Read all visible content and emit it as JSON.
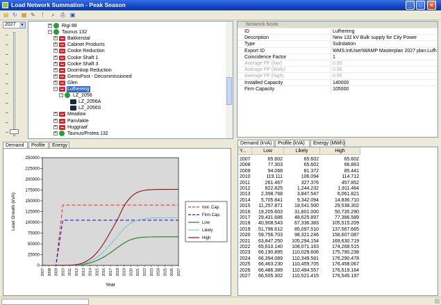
{
  "window": {
    "title": "Load Network Summation - Peak Season"
  },
  "year_selector": {
    "value": "2027"
  },
  "tree": {
    "nodes": [
      {
        "label": "Rigi 88",
        "icon": "green",
        "indent": 1,
        "expander": "+"
      },
      {
        "label": "Taunus 132",
        "icon": "green",
        "indent": 1,
        "expander": "-"
      },
      {
        "label": "Bakkerstal",
        "icon": "red",
        "indent": 2,
        "expander": "+"
      },
      {
        "label": "Cabinet Products",
        "icon": "red",
        "indent": 2,
        "expander": "+"
      },
      {
        "label": "Cooke Reduction",
        "icon": "red",
        "indent": 2,
        "expander": "+"
      },
      {
        "label": "Cooke Shaft 1",
        "icon": "red",
        "indent": 2,
        "expander": "+"
      },
      {
        "label": "Cooke Shaft 3",
        "icon": "red",
        "indent": 2,
        "expander": "+"
      },
      {
        "label": "Doornkop Reduction",
        "icon": "red",
        "indent": 2,
        "expander": "+"
      },
      {
        "label": "GemsPost - Decommissioned",
        "icon": "red",
        "indent": 2,
        "expander": "+"
      },
      {
        "label": "Glen",
        "icon": "red",
        "indent": 2,
        "expander": "+"
      },
      {
        "label": "Lufhereng",
        "icon": "red",
        "indent": 2,
        "expander": "-",
        "selected": true
      },
      {
        "label": "LZ_2056",
        "icon": "green",
        "indent": 3,
        "expander": "-"
      },
      {
        "label": "LZ_2056A",
        "icon": "dark",
        "indent": 4,
        "expander": ""
      },
      {
        "label": "LZ_2056S",
        "icon": "dark",
        "indent": 4,
        "expander": ""
      },
      {
        "label": "Meadow",
        "icon": "red",
        "indent": 2,
        "expander": "+"
      },
      {
        "label": "Panvlakte",
        "icon": "red",
        "indent": 2,
        "expander": "+"
      },
      {
        "label": "Huggraaf",
        "icon": "red",
        "indent": 2,
        "expander": "+"
      },
      {
        "label": "Taunus/Protea 132",
        "icon": "green",
        "indent": 2,
        "expander": "+"
      }
    ]
  },
  "properties": {
    "category": "Network Node",
    "rows": [
      {
        "key": "ID",
        "value": "Lufhereng",
        "disabled": false
      },
      {
        "key": "Description",
        "value": "New 132 kV Bulk supply for City Power",
        "disabled": false
      },
      {
        "key": "Type",
        "value": "Substation",
        "disabled": false
      },
      {
        "key": "Export ID",
        "value": "WMS.IntUser\\WAMP Masterplan 2027 plan.Lufh",
        "disabled": false
      },
      {
        "key": "Coincidence Factor",
        "value": "1",
        "disabled": false
      },
      {
        "key": "Average PF (low)",
        "value": "0.95",
        "disabled": true
      },
      {
        "key": "Average PF (likely)",
        "value": "0.95",
        "disabled": true
      },
      {
        "key": "Average PF (high)",
        "value": "0.95",
        "disabled": true
      },
      {
        "key": "Installed Capacity",
        "value": "140000",
        "disabled": false
      },
      {
        "key": "Firm Capacity",
        "value": "105000",
        "disabled": false
      }
    ]
  },
  "chart_tabs": [
    "Demand",
    "Profile",
    "Energy"
  ],
  "grid_tabs": [
    "Demand (kVA)",
    "Profile (kVA)",
    "Energy (MWh)"
  ],
  "grid": {
    "headers": [
      "Y...",
      "Low",
      "Likely",
      "High"
    ],
    "rows": [
      [
        "2007",
        "65.602",
        "65.602",
        "65.602"
      ],
      [
        "2008",
        "77.303",
        "65.602",
        "66.863"
      ],
      [
        "2009",
        "94.068",
        "81.372",
        "85.441"
      ],
      [
        "2010",
        "119.111",
        "106.094",
        "114.712"
      ],
      [
        "2011",
        "261.467",
        "327.376",
        "457.852"
      ],
      [
        "2012",
        "822.825",
        "1,244.232",
        "1,911.464"
      ],
      [
        "2013",
        "2,398.768",
        "3,847.547",
        "6,061.821"
      ],
      [
        "2014",
        "5,705.841",
        "9,342.094",
        "14,836.710"
      ],
      [
        "2015",
        "11,257.871",
        "18,541.500",
        "29,538.302"
      ],
      [
        "2016",
        "19,205.603",
        "31,801.000",
        "50,735.290"
      ],
      [
        "2017",
        "29,431.686",
        "48,625.897",
        "77,386.589"
      ],
      [
        "2018",
        "40,908.543",
        "67,336.383",
        "105,515.209"
      ],
      [
        "2019",
        "51,796.612",
        "85,097.510",
        "137,567.665"
      ],
      [
        "2020",
        "59,756.703",
        "98,321.246",
        "158,607.087"
      ],
      [
        "2021",
        "63,847.250",
        "105,294.154",
        "169,630.719"
      ],
      [
        "2022",
        "65,610.140",
        "108,071.163",
        "174,268.515"
      ],
      [
        "2023",
        "66,190.895",
        "110,029.606",
        "175,790.238"
      ],
      [
        "2024",
        "66,394.089",
        "110,349.581",
        "176,290.478"
      ],
      [
        "2025",
        "66,463.230",
        "110,459.705",
        "176,458.067"
      ],
      [
        "2026",
        "66,486.389",
        "110,494.557",
        "176,519.164"
      ],
      [
        "2027",
        "66,505.302",
        "110,521.415",
        "176,545.197"
      ]
    ]
  },
  "chart_data": {
    "type": "line",
    "xlabel": "Year",
    "ylabel": "Load Growth (kVA)",
    "ylim": [
      0,
      250000
    ],
    "yticks": [
      0,
      25000,
      50000,
      75000,
      100000,
      125000,
      150000,
      175000,
      200000,
      225000,
      250000
    ],
    "ytick_labels": [
      "0",
      "25000",
      "50000",
      "75000",
      "100000",
      "125000",
      "150000",
      "175000",
      "200000",
      "225000",
      "250000"
    ],
    "x": [
      2007,
      2008,
      2009,
      2010,
      2011,
      2012,
      2013,
      2014,
      2015,
      2016,
      2017,
      2018,
      2019,
      2020,
      2021,
      2022,
      2023,
      2024,
      2025,
      2026,
      2027
    ],
    "x_labels": [
      "2007",
      "2008",
      "2009",
      "2010",
      "2011",
      "2012",
      "2013",
      "2014",
      "2015",
      "2016",
      "2017",
      "2018",
      "2019",
      "2020",
      "2021",
      "2022",
      "2023",
      "2024",
      "2025",
      "2026",
      "2027"
    ],
    "legend_position": "right",
    "grid": false,
    "plot_background": "#d9d9d9",
    "series": [
      {
        "name": "Inst. Cap.",
        "color": "#ff2a2a",
        "dash": true,
        "values": [
          0,
          0,
          0,
          140000,
          140000,
          140000,
          140000,
          140000,
          140000,
          140000,
          140000,
          140000,
          140000,
          140000,
          140000,
          140000,
          140000,
          140000,
          140000,
          140000,
          140000
        ]
      },
      {
        "name": "Firm Cap.",
        "color": "#1a1acc",
        "dash": true,
        "values": [
          0,
          0,
          0,
          105000,
          105000,
          105000,
          105000,
          105000,
          105000,
          105000,
          105000,
          105000,
          105000,
          105000,
          105000,
          105000,
          105000,
          105000,
          105000,
          105000,
          105000
        ]
      },
      {
        "name": "Low",
        "color": "#1e7a1e",
        "dash": false,
        "values": [
          65.602,
          77.303,
          94.068,
          119.111,
          261.467,
          822.825,
          2398.768,
          5705.841,
          11257.871,
          19205.603,
          29431.686,
          40908.543,
          51796.612,
          59756.703,
          63847.25,
          65610.14,
          66190.895,
          66394.089,
          66463.23,
          66486.389,
          66505.302
        ]
      },
      {
        "name": "Likely",
        "color": "#7fc4c8",
        "dash": false,
        "values": [
          65.602,
          65.602,
          81.372,
          106.094,
          327.376,
          1244.232,
          3847.547,
          9342.094,
          18541.5,
          31801,
          48625.897,
          67336.383,
          85097.51,
          98321.246,
          105294.154,
          108071.163,
          110029.606,
          110349.581,
          110459.705,
          110494.557,
          110521.415
        ]
      },
      {
        "name": "High",
        "color": "#8b1010",
        "dash": false,
        "values": [
          65.602,
          66.863,
          85.441,
          114.712,
          457.852,
          1911.464,
          6061.821,
          14836.71,
          29538.302,
          50735.29,
          77386.589,
          105515.209,
          137567.665,
          158607.087,
          169630.719,
          174268.515,
          175790.238,
          176290.478,
          176458.067,
          176519.164,
          176545.197
        ]
      }
    ]
  }
}
